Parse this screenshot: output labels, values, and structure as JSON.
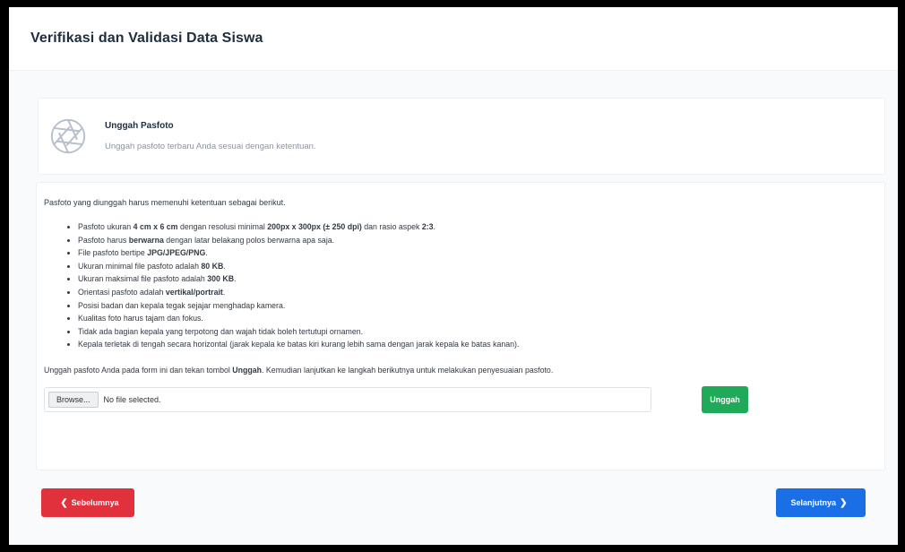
{
  "page": {
    "title": "Verifikasi dan Validasi Data Siswa"
  },
  "upload_card": {
    "icon": "camera-aperture-icon",
    "title": "Unggah Pasfoto",
    "subtitle": "Unggah pasfoto terbaru Anda sesuai dengan ketentuan."
  },
  "requirements": {
    "intro": "Pasfoto yang diunggah harus memenuhi ketentuan sebagai berikut.",
    "items": [
      [
        {
          "t": "Pasfoto ukuran "
        },
        {
          "t": "4 cm x 6 cm",
          "b": true
        },
        {
          "t": " dengan resolusi minimal "
        },
        {
          "t": "200px x 300px (± 250 dpi)",
          "b": true
        },
        {
          "t": " dan rasio aspek "
        },
        {
          "t": "2:3",
          "b": true
        },
        {
          "t": "."
        }
      ],
      [
        {
          "t": "Pasfoto harus "
        },
        {
          "t": "berwarna",
          "b": true
        },
        {
          "t": " dengan latar belakang polos berwarna apa saja."
        }
      ],
      [
        {
          "t": "File pasfoto bertipe "
        },
        {
          "t": "JPG/JPEG/PNG",
          "b": true
        },
        {
          "t": "."
        }
      ],
      [
        {
          "t": "Ukuran minimal file pasfoto adalah "
        },
        {
          "t": "80 KB",
          "b": true
        },
        {
          "t": "."
        }
      ],
      [
        {
          "t": "Ukuran maksimal file pasfoto adalah "
        },
        {
          "t": "300 KB",
          "b": true
        },
        {
          "t": "."
        }
      ],
      [
        {
          "t": "Orientasi pasfoto adalah "
        },
        {
          "t": "vertikal/portrait",
          "b": true
        },
        {
          "t": "."
        }
      ],
      [
        {
          "t": "Posisi badan dan kepala tegak sejajar menghadap kamera."
        }
      ],
      [
        {
          "t": "Kualitas foto harus tajam dan fokus."
        }
      ],
      [
        {
          "t": "Tidak ada bagian kepala yang terpotong dan wajah tidak boleh tertutupi ornamen."
        }
      ],
      [
        {
          "t": "Kepala terletak di tengah secara horizontal (jarak kepala ke batas kiri kurang lebih sama dengan jarak kepala ke batas kanan)."
        }
      ]
    ],
    "instruction_parts": [
      {
        "t": "Unggah pasfoto Anda pada form ini dan tekan tombol "
      },
      {
        "t": "Unggah",
        "b": true
      },
      {
        "t": ". Kemudian lanjutkan ke langkah berikutnya untuk melakukan penyesuaian pasfoto."
      }
    ]
  },
  "file_input": {
    "browse_label": "Browse...",
    "status": "No file selected."
  },
  "buttons": {
    "upload": "Unggah",
    "prev": "Sebelumnya",
    "next": "Selanjutnya",
    "prev_icon": "chevron-left-icon",
    "next_icon": "chevron-right-icon"
  },
  "colors": {
    "upload": "#1faa59",
    "prev": "#e0313c",
    "next": "#1b6fe6"
  }
}
